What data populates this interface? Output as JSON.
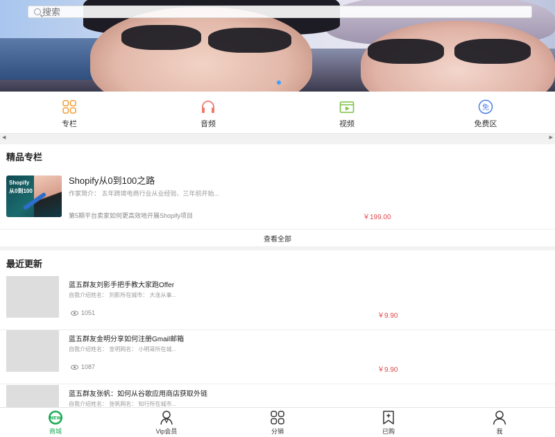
{
  "search": {
    "placeholder": "搜索"
  },
  "categories": [
    {
      "label": "专栏",
      "icon": "grid-icon",
      "color": "#f2a03a"
    },
    {
      "label": "音频",
      "icon": "headphones-icon",
      "color": "#f07a6b"
    },
    {
      "label": "视频",
      "icon": "video-icon",
      "color": "#7cc243"
    },
    {
      "label": "免费区",
      "icon": "free-badge-icon",
      "color": "#4b7ee8"
    }
  ],
  "featured": {
    "section_title": "精品专栏",
    "thumb_logo": "Shopify",
    "thumb_sub": "从0到100",
    "title": "Shopify从0到100之路",
    "desc": "作家简介：  五年跨境电商行业从业经验、三年前开始...",
    "note": "第5期平台卖家如何更高效地开展Shopify项目",
    "price": "￥199.00",
    "view_all": "查看全部"
  },
  "recent": {
    "section_title": "最近更新",
    "items": [
      {
        "title": "蓝五群友刘影手把手教大家跑Offer",
        "desc": "自我介绍姓名：  刘影所在城市：  大连从事...",
        "views": "1051",
        "price": "￥9.90"
      },
      {
        "title": "蓝五群友金明分享如何注册Gmail邮箱",
        "desc": "自我介绍姓名：  金明网名：  小明哥所在城...",
        "views": "1087",
        "price": "￥9.90"
      },
      {
        "title": "蓝五群友张帆：如何从谷歌应用商店获取外链",
        "desc": "自我介绍姓名：  张帆网名：  知行所在城市...",
        "views": "",
        "price": ""
      }
    ]
  },
  "tabbar": {
    "items": [
      {
        "label": "商城",
        "icon": "new-badge-icon",
        "active": true
      },
      {
        "label": "Vip会员",
        "icon": "vip-person-icon"
      },
      {
        "label": "分销",
        "icon": "grid-icon"
      },
      {
        "label": "已购",
        "icon": "bookmark-plus-icon"
      },
      {
        "label": "我",
        "icon": "person-icon"
      }
    ],
    "new_badge": "NEW",
    "active_color": "#1aab55"
  },
  "colors": {
    "price": "#e0484d",
    "accent": "#1aab55"
  }
}
